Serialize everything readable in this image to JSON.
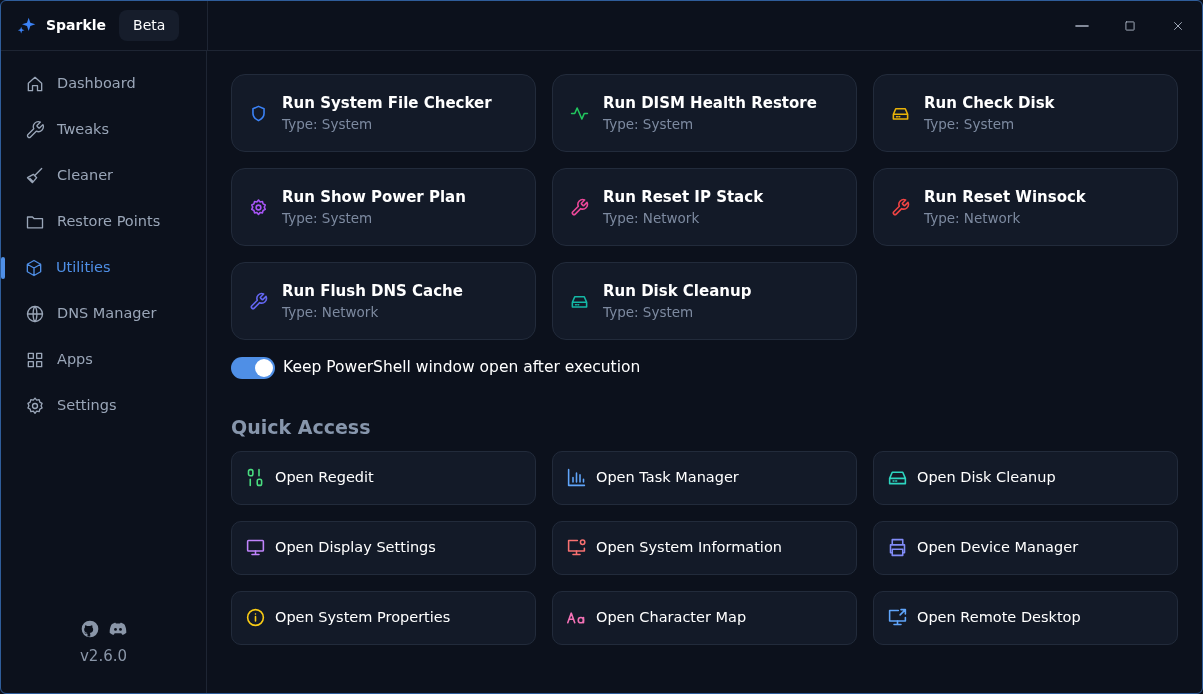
{
  "app": {
    "name": "Sparkle",
    "badge": "Beta"
  },
  "sidebar": {
    "items": [
      {
        "label": "Dashboard",
        "selected": false
      },
      {
        "label": "Tweaks",
        "selected": false
      },
      {
        "label": "Cleaner",
        "selected": false
      },
      {
        "label": "Restore Points",
        "selected": false
      },
      {
        "label": "Utilities",
        "selected": true
      },
      {
        "label": "DNS Manager",
        "selected": false
      },
      {
        "label": "Apps",
        "selected": false
      },
      {
        "label": "Settings",
        "selected": false
      }
    ],
    "version": "v2.6.0"
  },
  "tools": [
    {
      "title": "Run System File Checker",
      "type": "Type: System",
      "color": "#3b82f6"
    },
    {
      "title": "Run DISM Health Restore",
      "type": "Type: System",
      "color": "#22c55e"
    },
    {
      "title": "Run Check Disk",
      "type": "Type: System",
      "color": "#eab308"
    },
    {
      "title": "Run Show Power Plan",
      "type": "Type: System",
      "color": "#a855f7"
    },
    {
      "title": "Run Reset IP Stack",
      "type": "Type: Network",
      "color": "#ec4899"
    },
    {
      "title": "Run Reset Winsock",
      "type": "Type: Network",
      "color": "#ef4444"
    },
    {
      "title": "Run Flush DNS Cache",
      "type": "Type: Network",
      "color": "#6366f1"
    },
    {
      "title": "Run Disk Cleanup",
      "type": "Type: System",
      "color": "#14b8a6"
    }
  ],
  "keep_open": {
    "label": "Keep PowerShell window open after execution",
    "on": true
  },
  "quick_access": {
    "title": "Quick Access",
    "items": [
      {
        "label": "Open Regedit",
        "color": "#4ade80"
      },
      {
        "label": "Open Task Manager",
        "color": "#60a5fa"
      },
      {
        "label": "Open Disk Cleanup",
        "color": "#2dd4bf"
      },
      {
        "label": "Open Display Settings",
        "color": "#c084fc"
      },
      {
        "label": "Open System Information",
        "color": "#f87171"
      },
      {
        "label": "Open Device Manager",
        "color": "#818cf8"
      },
      {
        "label": "Open System Properties",
        "color": "#facc15"
      },
      {
        "label": "Open Character Map",
        "color": "#f472b6"
      },
      {
        "label": "Open Remote Desktop",
        "color": "#60a5fa"
      }
    ]
  }
}
